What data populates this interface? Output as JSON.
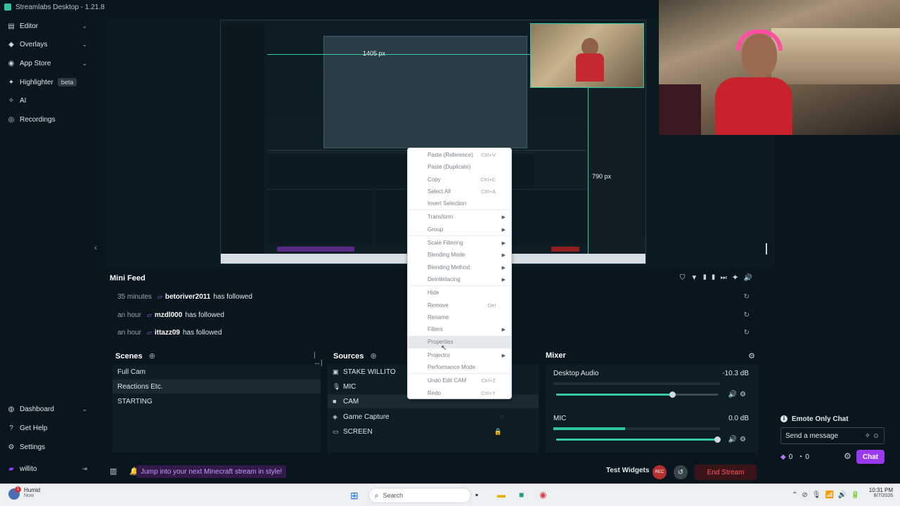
{
  "window": {
    "title": "Streamlabs Desktop - 1.21.8"
  },
  "sidebar": {
    "items": [
      {
        "label": "Editor",
        "icon": "editor-icon"
      },
      {
        "label": "Overlays",
        "icon": "overlays-icon"
      },
      {
        "label": "App Store",
        "icon": "app-store-icon"
      },
      {
        "label": "Highlighter",
        "badge": "beta",
        "icon": "highlighter-icon"
      },
      {
        "label": "AI",
        "icon": "ai-icon"
      },
      {
        "label": "Recordings",
        "icon": "recordings-icon"
      }
    ],
    "bottom": [
      {
        "label": "Dashboard",
        "icon": "dashboard-icon"
      },
      {
        "label": "Get Help",
        "icon": "help-icon"
      },
      {
        "label": "Settings",
        "icon": "gear-icon"
      }
    ],
    "user": {
      "name": "willito"
    }
  },
  "preview": {
    "width_label": "1405 px",
    "height_label": "790 px"
  },
  "context_menu": {
    "items": [
      {
        "label": "Paste (Reference)",
        "shortcut": "Ctrl+V"
      },
      {
        "label": "Paste (Duplicate)",
        "shortcut": ""
      },
      {
        "label": "Copy",
        "shortcut": "Ctrl+C"
      },
      {
        "label": "Select All",
        "shortcut": "Ctrl+A"
      },
      {
        "label": "Invert Selection",
        "shortcut": ""
      },
      {
        "label": "Transform",
        "shortcut": "",
        "submenu": true
      },
      {
        "label": "Group",
        "shortcut": "",
        "submenu": true
      },
      {
        "label": "Scale Filtering",
        "shortcut": "",
        "submenu": true
      },
      {
        "label": "Blending Mode",
        "shortcut": "",
        "submenu": true
      },
      {
        "label": "Blending Method",
        "shortcut": "",
        "submenu": true
      },
      {
        "label": "Deinterlacing",
        "shortcut": "",
        "submenu": true
      },
      {
        "label": "Hide",
        "shortcut": ""
      },
      {
        "label": "Remove",
        "shortcut": "Del"
      },
      {
        "label": "Rename",
        "shortcut": ""
      },
      {
        "label": "Filters",
        "shortcut": "",
        "submenu": true
      },
      {
        "label": "Properties",
        "shortcut": ""
      },
      {
        "label": "Projector",
        "shortcut": "",
        "submenu": true
      },
      {
        "label": "Performance Mode",
        "shortcut": ""
      },
      {
        "label": "Undo Edit CAM",
        "shortcut": "Ctrl+Z"
      },
      {
        "label": "Redo",
        "shortcut": "Ctrl+Y"
      }
    ]
  },
  "mini_feed": {
    "title": "Mini Feed",
    "rows": [
      {
        "time": "35 minutes",
        "user": "betoriver2011",
        "action": "has followed"
      },
      {
        "time": "an hour",
        "user": "mzdl000",
        "action": "has followed"
      },
      {
        "time": "an hour",
        "user": "ittazz09",
        "action": "has followed"
      }
    ]
  },
  "scenes": {
    "title": "Scenes",
    "items": [
      "Full Cam",
      "Reactions Etc.",
      "STARTING"
    ],
    "active_index": 1
  },
  "sources": {
    "title": "Sources",
    "items": [
      {
        "label": "STAKE WILLITO",
        "icon": "image-icon"
      },
      {
        "label": "MIC",
        "icon": "mic-icon"
      },
      {
        "label": "CAM",
        "icon": "camera-icon"
      },
      {
        "label": "Game Capture",
        "icon": "gamepad-icon"
      },
      {
        "label": "SCREEN",
        "icon": "monitor-icon"
      }
    ],
    "active_index": 2
  },
  "mixer": {
    "title": "Mixer",
    "channels": [
      {
        "name": "Desktop Audio",
        "db": "-10.3 dB",
        "level": 0.0,
        "volume": 0.72
      },
      {
        "name": "MIC",
        "db": "0.0 dB",
        "level": 0.43,
        "volume": 1.0
      }
    ]
  },
  "chat": {
    "emote_only_label": "Emote Only Chat",
    "input_placeholder": "Send a message",
    "count_a": "0",
    "count_b": "0",
    "chat_button": "Chat"
  },
  "status_bar": {
    "promo_text": "Jump into your next Minecraft stream in style!",
    "test_widgets": "Test Widgets",
    "rec_label": "REC",
    "end_stream": "End Stream"
  },
  "taskbar": {
    "weather_label": "Humid",
    "weather_sub": "Now",
    "notif_count": "1",
    "search_label": "Search",
    "time": "10:31 PM",
    "date": "8/7/2026"
  },
  "colors": {
    "accent_green": "#31c3a2",
    "accent_purple": "#9b39f0",
    "end_stream_red": "#ff5a5a"
  }
}
